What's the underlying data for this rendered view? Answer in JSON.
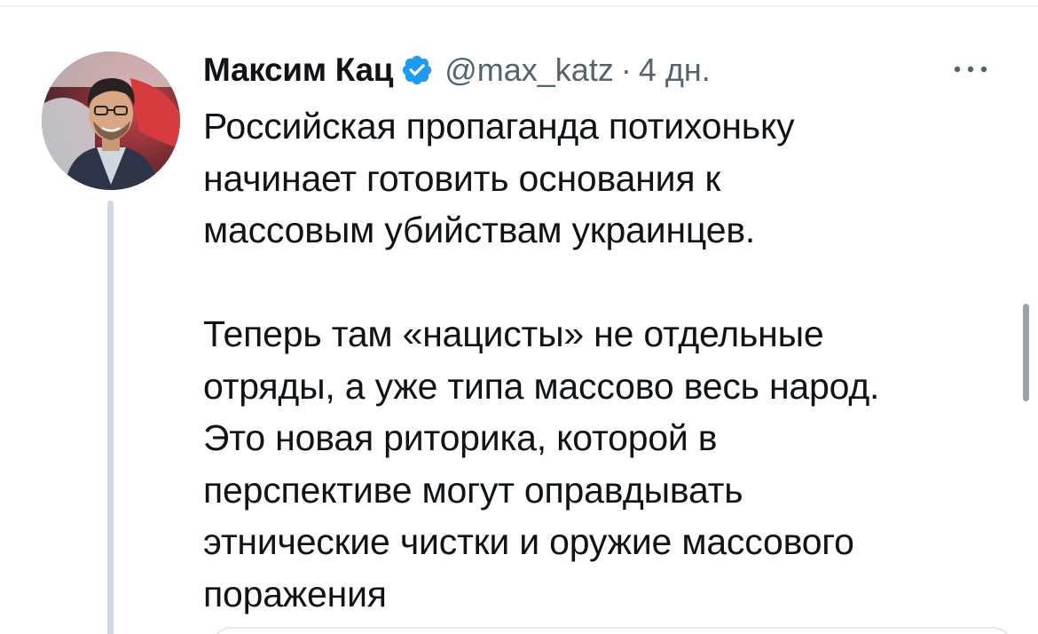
{
  "tweet": {
    "display_name": "Максим Кац",
    "verified": true,
    "handle": "@max_katz",
    "separator": "·",
    "timestamp": "4 дн.",
    "text": "Российская пропаганда потихоньку\nначинает готовить основания к\nмассовым убийствам украинцев.\n\nТеперь там «нацисты» не отдельные\nотряды, а уже типа массово весь народ.\nЭто новая риторика, которой в\nперспективе могут оправдывать\nэтнические чистки и оружие массового\nпоражения"
  },
  "icons": {
    "verified": "verified-badge-icon",
    "more": "more-options-icon"
  },
  "colors": {
    "text_primary": "#0f1419",
    "text_secondary": "#536471",
    "verified_blue": "#1d9bf0",
    "thread_line": "#cfd9de"
  }
}
